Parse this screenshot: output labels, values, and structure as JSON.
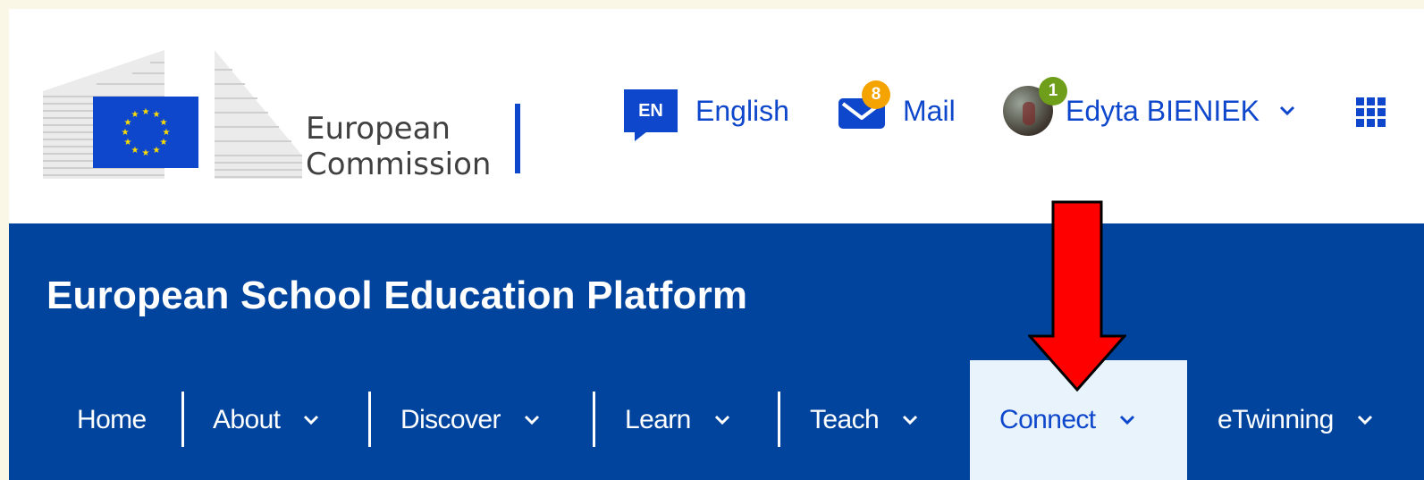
{
  "logo": {
    "line1": "European",
    "line2": "Commission"
  },
  "utility": {
    "language_code": "EN",
    "language_label": "English",
    "mail_label": "Mail",
    "mail_count": "8",
    "user_name": "Edyta BIENIEK",
    "user_count": "1"
  },
  "site_title": "European School Education Platform",
  "nav": {
    "items": [
      {
        "label": "Home"
      },
      {
        "label": "About"
      },
      {
        "label": "Discover"
      },
      {
        "label": "Learn"
      },
      {
        "label": "Teach"
      },
      {
        "label": "Connect",
        "active": true
      },
      {
        "label": "eTwinning"
      }
    ]
  },
  "colors": {
    "brand_blue": "#00449e",
    "link_blue": "#0e47cb",
    "active_tab_bg": "#e8f3fc",
    "mail_badge": "#f4a300",
    "user_badge": "#6e9e1a",
    "annotation_arrow": "#ff0000"
  },
  "icons": [
    "eu-flag-icon",
    "speech-bubble-icon",
    "envelope-icon",
    "chevron-down-icon",
    "app-grid-icon",
    "down-arrow-icon"
  ]
}
